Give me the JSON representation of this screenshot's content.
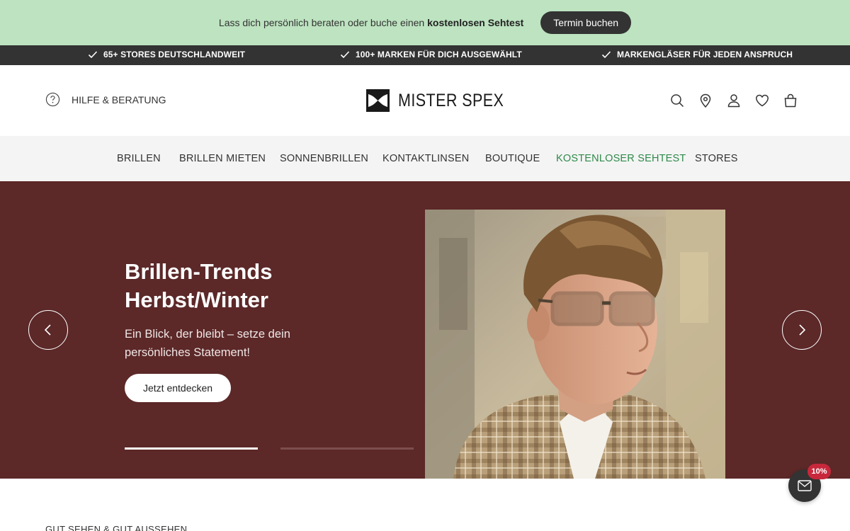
{
  "promo": {
    "text_prefix": "Lass dich persönlich beraten oder buche einen ",
    "text_bold": "kostenlosen Sehtest",
    "button_label": "Termin buchen"
  },
  "usp": {
    "items": [
      {
        "label": "65+ STORES DEUTSCHLANDWEIT",
        "icon": "check-icon"
      },
      {
        "label": "100+ MARKEN FÜR DICH AUSGEWÄHLT",
        "icon": "check-icon"
      },
      {
        "label": "MARKENGLÄSER FÜR JEDEN ANSPRUCH",
        "icon": "check-icon"
      }
    ]
  },
  "header": {
    "help_label": "HILFE & BERATUNG",
    "logo_text": "MISTER SPEX",
    "icons": [
      "search-icon",
      "store-locator-icon",
      "account-icon",
      "wishlist-icon",
      "cart-icon"
    ]
  },
  "nav": {
    "items": [
      {
        "label": "BRILLEN"
      },
      {
        "label": "BRILLEN MIETEN"
      },
      {
        "label": "SONNENBRILLEN"
      },
      {
        "label": "KONTAKTLINSEN"
      },
      {
        "label": "BOUTIQUE"
      },
      {
        "label": "KOSTENLOSER SEHTEST"
      },
      {
        "label": "STORES"
      }
    ],
    "accent_color": "#2e8a4a"
  },
  "hero": {
    "title_line1": "Brillen-Trends",
    "title_line2": "Herbst/Winter",
    "subtitle": "Ein Blick, der bleibt – setze dein persönliches Statement!",
    "cta_label": "Jetzt entdecken",
    "background_color": "#5c2828",
    "slide_count": 2,
    "active_slide": 1
  },
  "section": {
    "label": "GUT SEHEN & GUT AUSSEHEN"
  },
  "newsletter": {
    "badge": "10%",
    "icon": "mail-icon"
  },
  "colors": {
    "promo_bg": "#bde3c0",
    "usp_bg": "#333333",
    "nav_bg": "#f4f4f4",
    "badge": "#c8283c"
  }
}
